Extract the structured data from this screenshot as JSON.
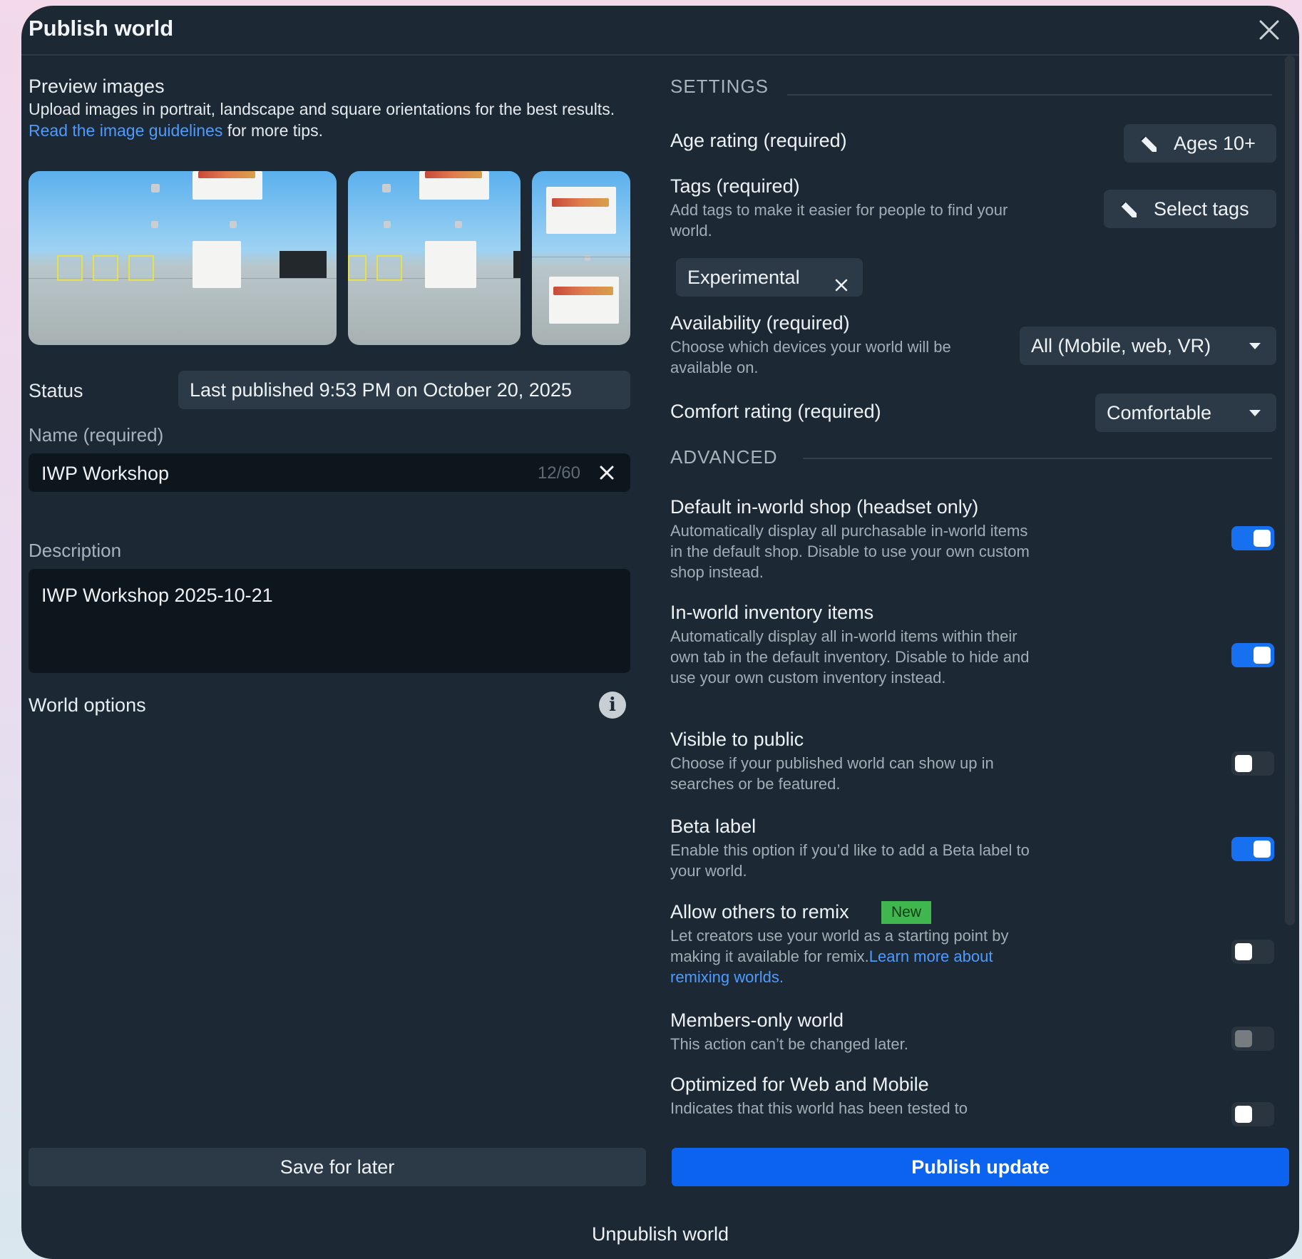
{
  "header": {
    "title": "Publish world"
  },
  "preview": {
    "heading": "Preview images",
    "instructions_prefix": "Upload images in portrait, landscape and square orientations for the best results. ",
    "guidelines_link": "Read the image guidelines",
    "instructions_suffix": " for more tips."
  },
  "status": {
    "label": "Status",
    "value": "Last published 9:53 PM on October 20, 2025"
  },
  "name": {
    "label": "Name (required)",
    "value": "IWP Workshop",
    "count": "12/60"
  },
  "description": {
    "label": "Description",
    "value": "IWP Workshop 2025-10-21"
  },
  "world_options": {
    "label": "World options"
  },
  "settings": {
    "heading": "SETTINGS",
    "age_rating": {
      "label": "Age rating (required)",
      "button": "Ages 10+"
    },
    "tags": {
      "label": "Tags (required)",
      "desc": "Add tags to make it easier for people to find your world.",
      "button": "Select tags",
      "chips": [
        "Experimental"
      ]
    },
    "availability": {
      "label": "Availability (required)",
      "desc": "Choose which devices your world will be available on.",
      "value": "All (Mobile, web, VR)"
    },
    "comfort": {
      "label": "Comfort rating (required)",
      "value": "Comfortable"
    }
  },
  "advanced": {
    "heading": "ADVANCED",
    "items": [
      {
        "title": "Default in-world shop (headset only)",
        "desc": "Automatically display all purchasable in-world items in the default shop. Disable to use your own custom shop instead.",
        "enabled": true
      },
      {
        "title": "In-world inventory items",
        "desc": "Automatically display all in-world items within their own tab in the default inventory. Disable to hide and use your own custom inventory instead.",
        "enabled": true
      },
      {
        "title": "Visible to public",
        "desc": "Choose if your published world can show up in searches or be featured.",
        "enabled": false
      },
      {
        "title": "Beta label",
        "desc": "Enable this option if you’d like to add a Beta label to your world.",
        "enabled": true
      },
      {
        "title": "Allow others to remix",
        "badge": "New",
        "desc": "Let creators use your world as a starting point by making it available for remix.",
        "link": "Learn more about remixing worlds.",
        "enabled": false
      },
      {
        "title": "Members-only world",
        "desc": "This action can’t be changed later.",
        "enabled": false,
        "disabled": true
      },
      {
        "title": "Optimized for Web and Mobile",
        "desc": "Indicates that this world has been tested to",
        "enabled": false
      }
    ]
  },
  "footer": {
    "save": "Save for later",
    "publish": "Publish update",
    "unpublish": "Unpublish world"
  },
  "colors": {
    "primary": "#0b63f0",
    "toggle_on": "#1670f0",
    "badge_new": "#3fb64e",
    "link": "#4e9bff"
  },
  "icons": [
    "close-icon",
    "clear-icon",
    "info-icon",
    "pencil-icon",
    "remove-tag-icon",
    "caret-down-icon"
  ]
}
